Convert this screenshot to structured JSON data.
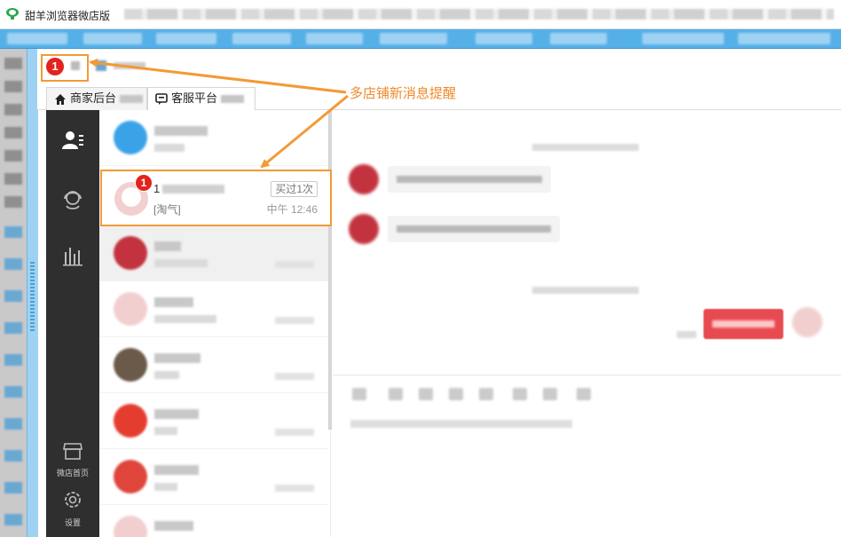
{
  "app": {
    "title": "甜羊浏览器微店版"
  },
  "shop_tabs": [
    {
      "badge": "1"
    }
  ],
  "main_tabs": [
    {
      "label": "商家后台",
      "icon": "home-icon"
    },
    {
      "label": "客服平台",
      "icon": "chat-bubble-icon"
    }
  ],
  "sidebar": {
    "items": [
      {
        "icon": "contacts-icon",
        "label": ""
      },
      {
        "icon": "customer-service-icon",
        "label": ""
      },
      {
        "icon": "bar-chart-icon",
        "label": ""
      },
      {
        "icon": "store-icon",
        "label": "微店首页"
      },
      {
        "icon": "settings-gear-icon",
        "label": "设置"
      }
    ]
  },
  "annotation": {
    "text": "多店铺新消息提醒",
    "color": "#EE8A2A"
  },
  "highlighted_conversation": {
    "name_prefix": "1",
    "badge": "1",
    "tag": "买过1次",
    "message": "[淘气]",
    "time": "中午 12:46"
  },
  "colors": {
    "accent_orange": "#F39A36",
    "badge_red": "#E4231D",
    "sidebar_dark": "#2F2F2F",
    "bookmark_blue": "#56B0E8"
  }
}
